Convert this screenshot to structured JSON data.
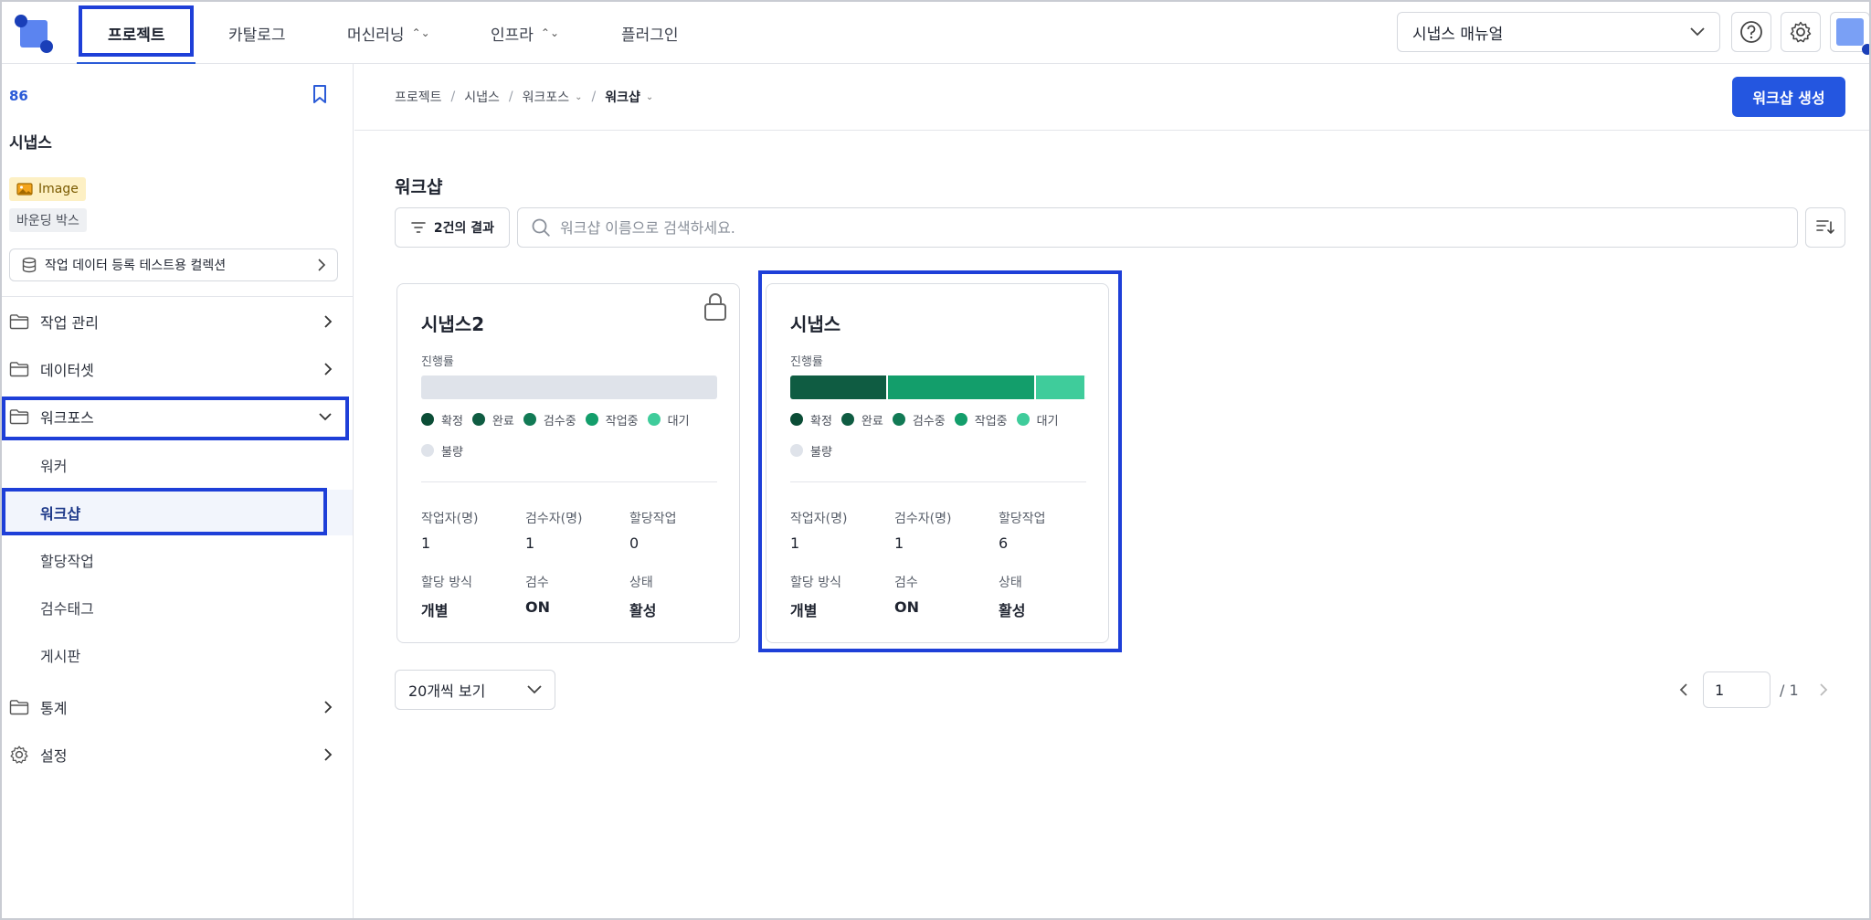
{
  "nav": {
    "tabs": [
      {
        "label": "프로젝트"
      },
      {
        "label": "카탈로그"
      },
      {
        "label": "머신러닝"
      },
      {
        "label": "인프라"
      },
      {
        "label": "플러그인"
      }
    ],
    "manual_select": "시냅스 매뉴얼"
  },
  "sidebar": {
    "project_id": "86",
    "project_name": "시냅스",
    "tag_image": "Image",
    "tag_bbox": "바운딩 박스",
    "collection": "작업 데이터 등록 테스트용 컬렉션",
    "items": {
      "task_mgmt": "작업 관리",
      "dataset": "데이터셋",
      "workforce": "워크포스",
      "stats": "통계",
      "settings": "설정"
    },
    "sub": {
      "worker": "워커",
      "workshop": "워크샵",
      "assignment": "할당작업",
      "review_tag": "검수태그",
      "board": "게시판"
    }
  },
  "main": {
    "breadcrumb": [
      "프로젝트",
      "시냅스",
      "워크포스",
      "워크샵"
    ],
    "create_button": "워크샵 생성",
    "title": "워크샵",
    "filter_count": "2건의 결과",
    "search_placeholder": "워크샵 이름으로 검색하세요.",
    "progress_label": "진행률",
    "legend": [
      {
        "label": "확정",
        "color": "#0b4d36"
      },
      {
        "label": "완료",
        "color": "#0f5c42"
      },
      {
        "label": "검수중",
        "color": "#127a55"
      },
      {
        "label": "작업중",
        "color": "#139e6b"
      },
      {
        "label": "대기",
        "color": "#3fcc9b"
      },
      {
        "label": "불량",
        "color": "#dfe3ea"
      }
    ],
    "stat_labels": {
      "workers": "작업자(명)",
      "reviewers": "검수자(명)",
      "assigned": "할당작업",
      "method": "할당 방식",
      "review": "검수",
      "status": "상태"
    },
    "cards": [
      {
        "name": "시냅스2",
        "locked": true,
        "progress": {
          "완료": 0,
          "작업중": 0,
          "대기": 0
        },
        "workers": "1",
        "reviewers": "1",
        "assigned": "0",
        "method": "개별",
        "review": "ON",
        "status": "활성"
      },
      {
        "name": "시냅스",
        "locked": false,
        "progress": {
          "완료": 0.33,
          "작업중": 0.5,
          "대기": 0.17
        },
        "workers": "1",
        "reviewers": "1",
        "assigned": "6",
        "method": "개별",
        "review": "ON",
        "status": "활성"
      }
    ],
    "per_page": "20개씩 보기",
    "page_current": "1",
    "page_total": "/ 1"
  }
}
